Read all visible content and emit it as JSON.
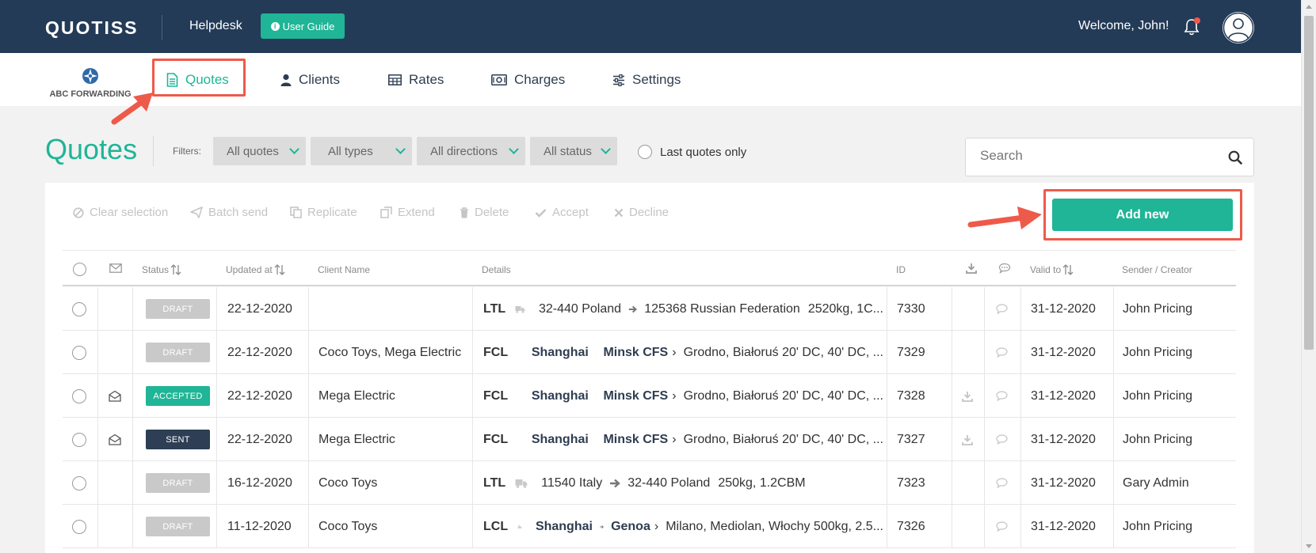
{
  "app": {
    "logo": "QUOTISS",
    "helpdesk": "Helpdesk",
    "user_guide": "User Guide",
    "welcome": "Welcome, John!"
  },
  "brand": {
    "name": "ABC FORWARDING"
  },
  "nav": {
    "items": [
      {
        "label": "Quotes",
        "icon": "document-icon",
        "active": true
      },
      {
        "label": "Clients",
        "icon": "user-icon"
      },
      {
        "label": "Rates",
        "icon": "table-icon"
      },
      {
        "label": "Charges",
        "icon": "money-icon"
      },
      {
        "label": "Settings",
        "icon": "sliders-icon"
      }
    ]
  },
  "page": {
    "title": "Quotes",
    "filters_label": "Filters:",
    "filters": [
      "All quotes",
      "All types",
      "All directions",
      "All status"
    ],
    "last_quotes_only": "Last quotes only",
    "search_placeholder": "Search"
  },
  "toolbar": {
    "actions": [
      "Clear selection",
      "Batch send",
      "Replicate",
      "Extend",
      "Delete",
      "Accept",
      "Decline"
    ],
    "add_new": "Add new"
  },
  "table": {
    "columns": [
      "Status",
      "Updated at",
      "Client Name",
      "Details",
      "ID",
      "Valid to",
      "Sender / Creator"
    ],
    "rows": [
      {
        "envelope": false,
        "status": "DRAFT",
        "updated": "22-12-2020",
        "client": "",
        "mode": "LTL",
        "vehicle": "truck",
        "from": "32-440 Poland",
        "from_bold": false,
        "to": "125368 Russian Federation",
        "to_bold": false,
        "extra": "2520kg, 1C...",
        "id": "7330",
        "download": false,
        "valid": "31-12-2020",
        "sender": "John Pricing"
      },
      {
        "envelope": false,
        "status": "DRAFT",
        "updated": "22-12-2020",
        "client": "Coco Toys, Mega Electric",
        "mode": "FCL",
        "vehicle": "ship",
        "from": "Shanghai",
        "from_bold": true,
        "to": "Minsk CFS",
        "to_bold": true,
        "extra": "Grodno, Białoruś 20' DC, 40' DC, ...",
        "id": "7329",
        "download": false,
        "valid": "31-12-2020",
        "sender": "John Pricing"
      },
      {
        "envelope": true,
        "status": "ACCEPTED",
        "updated": "22-12-2020",
        "client": "Mega Electric",
        "mode": "FCL",
        "vehicle": "ship",
        "from": "Shanghai",
        "from_bold": true,
        "to": "Minsk CFS",
        "to_bold": true,
        "extra": "Grodno, Białoruś 20' DC, 40' DC, ...",
        "id": "7328",
        "download": true,
        "valid": "31-12-2020",
        "sender": "John Pricing"
      },
      {
        "envelope": true,
        "status": "SENT",
        "updated": "22-12-2020",
        "client": "Mega Electric",
        "mode": "FCL",
        "vehicle": "ship",
        "from": "Shanghai",
        "from_bold": true,
        "to": "Minsk CFS",
        "to_bold": true,
        "extra": "Grodno, Białoruś 20' DC, 40' DC, ...",
        "id": "7327",
        "download": true,
        "valid": "31-12-2020",
        "sender": "John Pricing"
      },
      {
        "envelope": false,
        "status": "DRAFT",
        "updated": "16-12-2020",
        "client": "Coco Toys",
        "mode": "LTL",
        "vehicle": "truck",
        "from": "11540 Italy",
        "from_bold": false,
        "to": "32-440 Poland",
        "to_bold": false,
        "extra": "250kg, 1.2CBM",
        "id": "7323",
        "download": false,
        "valid": "31-12-2020",
        "sender": "Gary Admin"
      },
      {
        "envelope": false,
        "status": "DRAFT",
        "updated": "11-12-2020",
        "client": "Coco Toys",
        "mode": "LCL",
        "vehicle": "ship",
        "from": "Shanghai",
        "from_bold": true,
        "to": "Genoa",
        "to_bold": true,
        "extra": "Milano, Mediolan, Włochy 500kg, 2.5...",
        "id": "7326",
        "download": false,
        "valid": "31-12-2020",
        "sender": "John Pricing"
      }
    ]
  },
  "colors": {
    "topbar": "#233b57",
    "accent": "#1fb596",
    "highlight": "#ee5a4a",
    "draft": "#c9c9c9",
    "accepted": "#1fb596",
    "sent": "#2d3e55"
  }
}
